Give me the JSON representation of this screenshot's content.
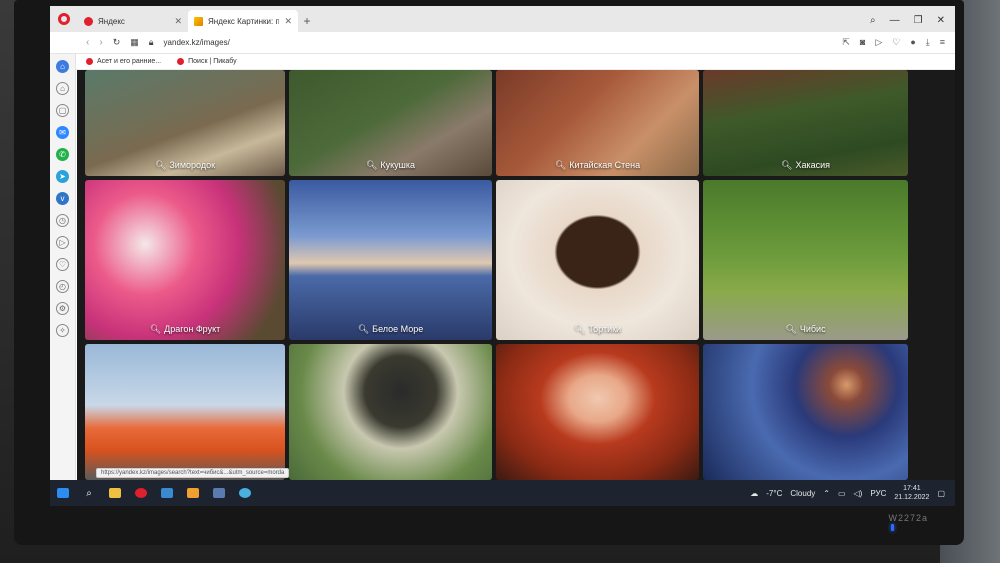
{
  "browser": {
    "tabs": [
      {
        "label": "Яндекс",
        "active": false
      },
      {
        "label": "Яндекс Картинки: поиск ...",
        "active": true
      }
    ],
    "new_tab": "+",
    "url": "yandex.kz/images/",
    "bookmarks": [
      "Асет и его ранние...",
      "Поиск | Пикабу"
    ],
    "status_url": "https://yandex.kz/images/search?text=чибис&...&utm_source=morda"
  },
  "grid": {
    "row1": [
      "Зимородок",
      "Кукушка",
      "Китайская Стена",
      "Хакасия"
    ],
    "row2": [
      "Драгон Фрукт",
      "Белое Море",
      "Тортики",
      "Чибис"
    ],
    "row3": [
      "",
      "",
      "",
      ""
    ]
  },
  "taskbar": {
    "weather_temp": "-7°C",
    "weather_text": "Cloudy",
    "lang": "РУС",
    "time": "17:41",
    "date": "21.12.2022"
  },
  "monitor": {
    "brand": "W2272a"
  },
  "colors": {
    "accent": "#e0202c",
    "taskbar": "#1d2430"
  }
}
